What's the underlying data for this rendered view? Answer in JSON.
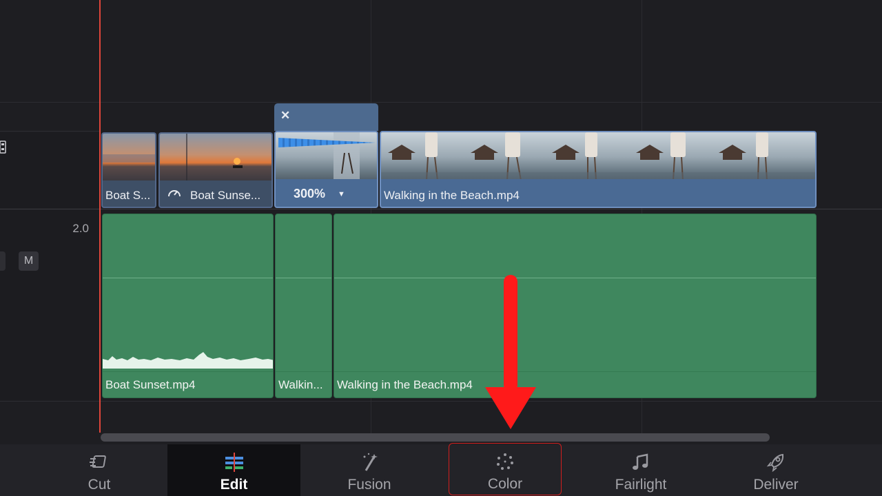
{
  "timeline": {
    "video_track": {
      "clips": [
        {
          "label": "Boat S..."
        },
        {
          "label": "Boat Sunse..."
        },
        {
          "label": "300%",
          "speed_menu": "▼",
          "close": "✕"
        },
        {
          "label": "Walking in the Beach.mp4"
        }
      ]
    },
    "audio_track": {
      "channels": "2.0",
      "mute_label": "M",
      "clips": [
        {
          "label": "Boat Sunset.mp4"
        },
        {
          "label": "Walkin..."
        },
        {
          "label": "Walking in the Beach.mp4"
        }
      ]
    }
  },
  "pages": [
    {
      "label": "Cut",
      "icon": "cut-page-icon"
    },
    {
      "label": "Edit",
      "icon": "edit-page-icon",
      "active": true
    },
    {
      "label": "Fusion",
      "icon": "fusion-wand-icon"
    },
    {
      "label": "Color",
      "icon": "color-wheel-icon",
      "highlighted": true
    },
    {
      "label": "Fairlight",
      "icon": "music-note-icon"
    },
    {
      "label": "Deliver",
      "icon": "rocket-icon"
    }
  ],
  "colors": {
    "playhead": "#e0453a",
    "video_clip": "#3e4f66",
    "audio_clip": "#3f875e",
    "annotation_arrow": "#ff1a1a",
    "highlight_box": "#d21e1e"
  }
}
